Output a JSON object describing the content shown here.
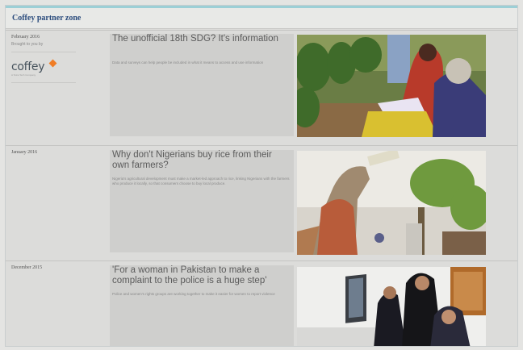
{
  "header": {
    "zone_title": "Coffey partner zone"
  },
  "sponsor": {
    "label": "Brought to you by",
    "logo_text": "coffey",
    "logo_tagline": "A Tetra Tech Company"
  },
  "articles": [
    {
      "date": "February 2016",
      "title": "The unofficial 18th SDG? It's information",
      "description": "Data and surveys can help people be included in what it means to access and use information"
    },
    {
      "date": "January 2016",
      "title": "Why don't Nigerians buy rice from their own farmers?",
      "description": "Nigeria's agricultural development must make a market-led approach to rice, linking Nigerians with the farmers who produce it locally, so that consumers choose to buy local produce."
    },
    {
      "date": "December 2015",
      "title": "'For a woman in Pakistan to make a complaint to the police is a huge step'",
      "description": "Police and women's rights groups are working together to make it easier for women to report violence"
    }
  ],
  "colors": {
    "title_blue": "#2a4b7c",
    "accent_teal": "#9ccfd6",
    "logo_orange": "#f07d25"
  },
  "icons": [
    "coffey-logo-mark"
  ]
}
